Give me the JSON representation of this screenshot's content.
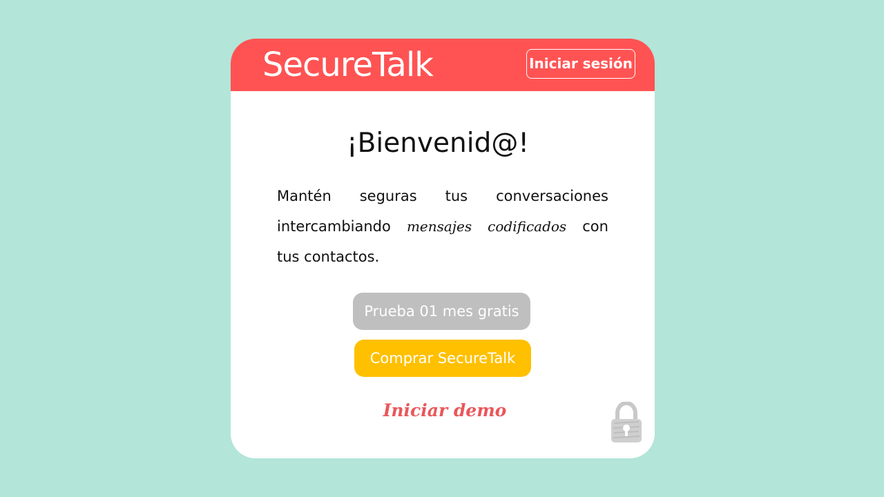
{
  "header": {
    "brand": "SecureTalk",
    "login_label": "Iniciar sesión",
    "color": "#ff5353"
  },
  "main": {
    "welcome": "¡Bienvenid@!",
    "description": {
      "line1": [
        "Mantén",
        "seguras",
        "tus",
        "conversaciones"
      ],
      "line2_start": "intercambiando",
      "line2_emphasis_1": "mensajes",
      "line2_emphasis_2": "codificados",
      "line2_end": "con",
      "line3": "tus contactos."
    },
    "trial_label": "Prueba 01 mes gratis",
    "buy_label": "Comprar SecureTalk",
    "demo_label": "Iniciar demo",
    "icons": {
      "lock": "lock-icon"
    }
  },
  "colors": {
    "background": "#b3e5d9",
    "trial_button": "#bfbfbf",
    "buy_button": "#ffc000",
    "demo_link": "#e9575a"
  }
}
